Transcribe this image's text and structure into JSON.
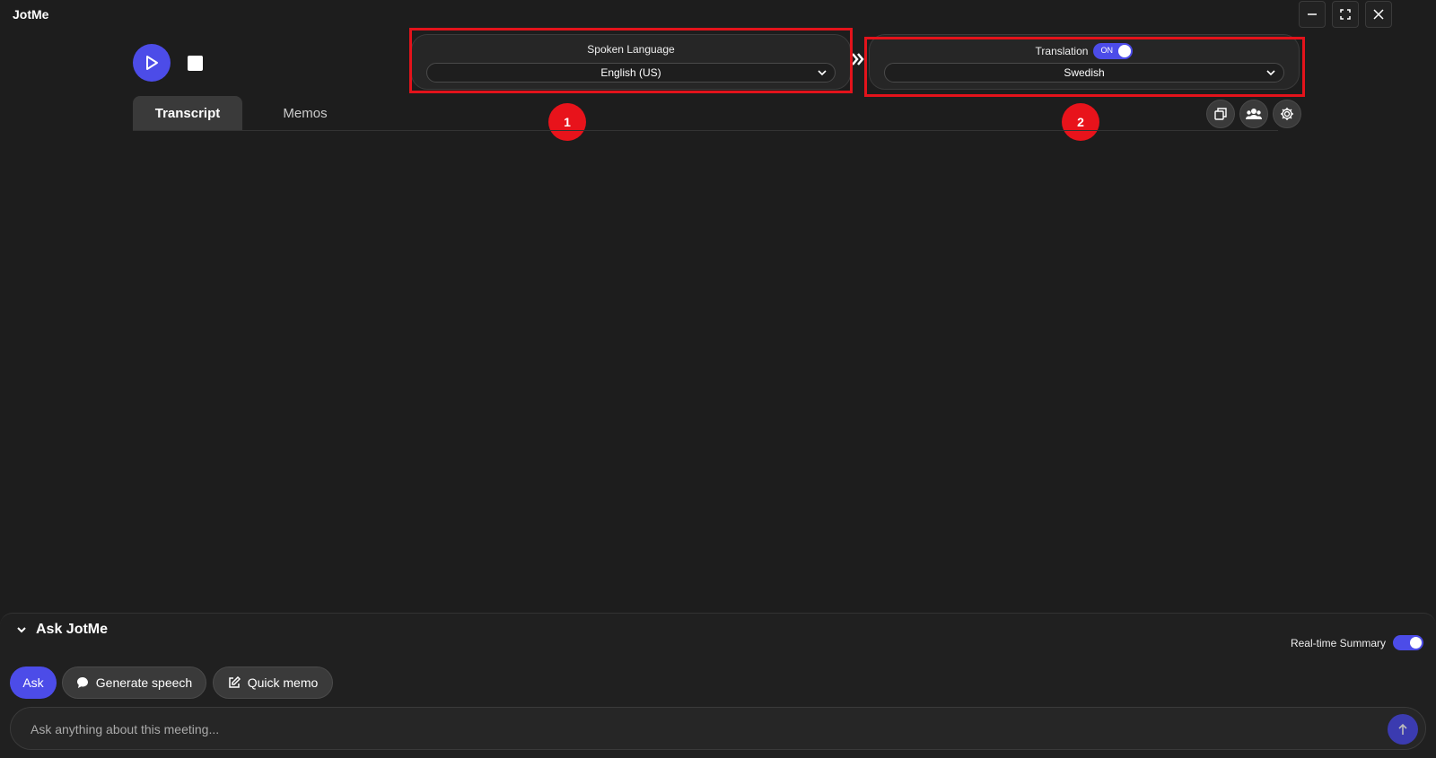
{
  "app": {
    "title": "JotMe"
  },
  "window_controls": [
    "minimize-icon",
    "fullscreen-icon",
    "close-icon"
  ],
  "recording": {
    "play_icon": "play-icon",
    "stop_icon": "stop-icon"
  },
  "spoken_language": {
    "label": "Spoken Language",
    "selected": "English (US)"
  },
  "translation": {
    "label": "Translation",
    "toggle_label": "ON",
    "enabled": true,
    "selected": "Swedish"
  },
  "annotations": [
    {
      "number": "1",
      "target": "spoken-language-panel"
    },
    {
      "number": "2",
      "target": "translation-panel"
    }
  ],
  "tabs": [
    {
      "label": "Transcript",
      "active": true
    },
    {
      "label": "Memos",
      "active": false
    }
  ],
  "toolbar_icons": [
    "copy-icon",
    "speakers-icon",
    "settings-icon"
  ],
  "ask_panel": {
    "title": "Ask JotMe",
    "realtime_summary_label": "Real-time Summary",
    "realtime_summary_enabled": true,
    "actions": {
      "ask": "Ask",
      "generate_speech": "Generate speech",
      "quick_memo": "Quick memo"
    },
    "input_placeholder": "Ask anything about this meeting..."
  },
  "colors": {
    "accent": "#4c4ce8",
    "background": "#1d1d1d",
    "annotation": "#e3131b"
  }
}
